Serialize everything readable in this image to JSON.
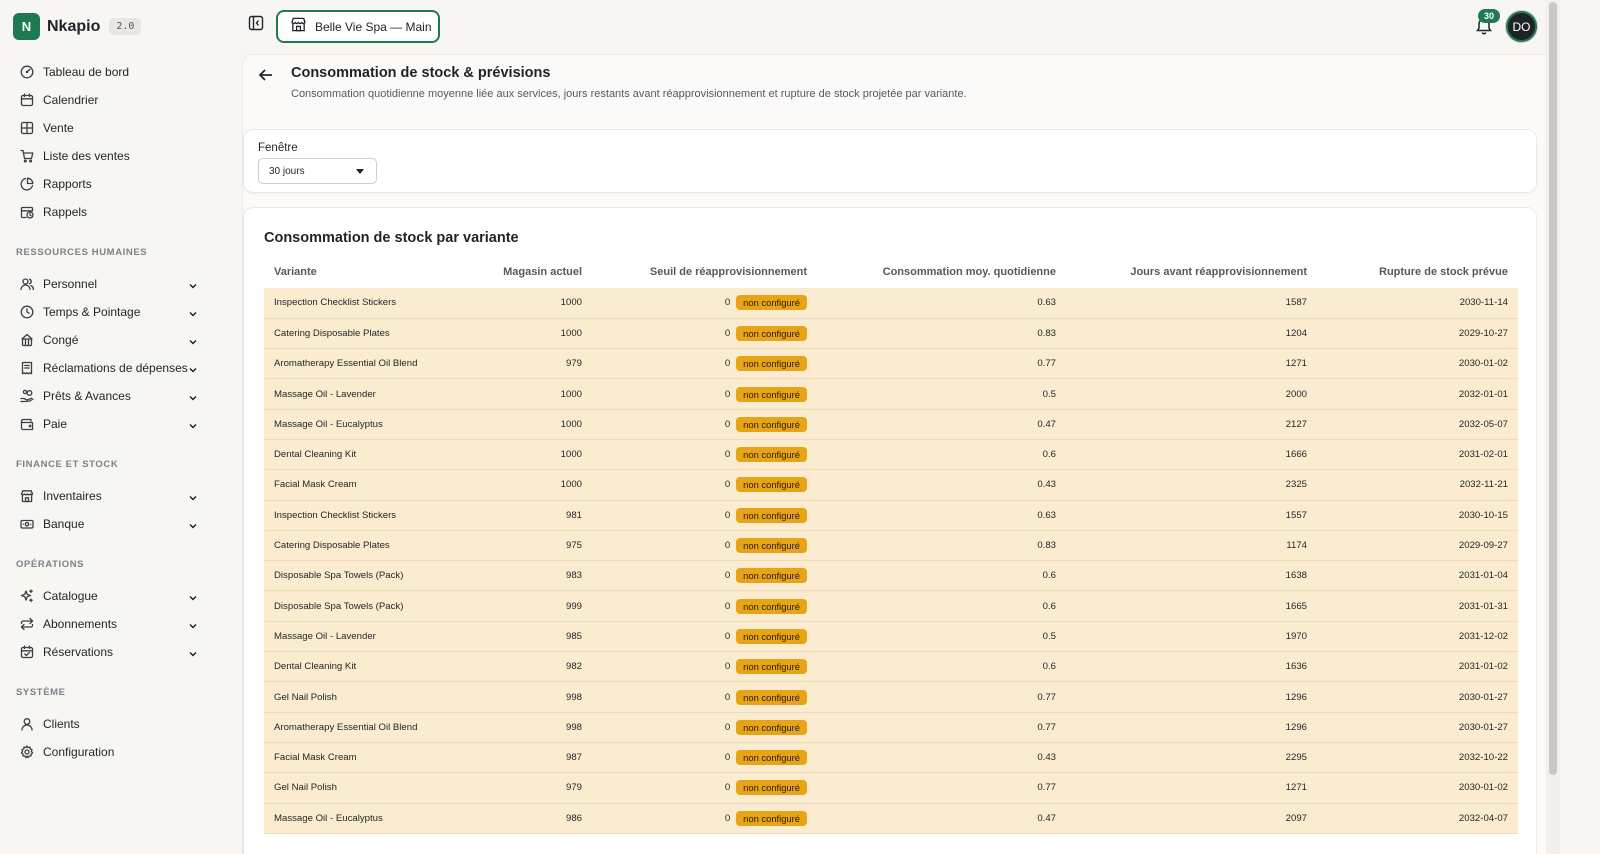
{
  "brand": {
    "logo_letter": "N",
    "name": "Nkapio",
    "version": "2.0"
  },
  "store": {
    "label": "Belle Vie Spa — Main"
  },
  "notifications": {
    "count": "30"
  },
  "user": {
    "initials": "DO"
  },
  "nav": {
    "top": [
      {
        "label": "Tableau de bord",
        "icon": "dashboard-icon"
      },
      {
        "label": "Calendrier",
        "icon": "calendar-icon"
      },
      {
        "label": "Vente",
        "icon": "grid-icon"
      },
      {
        "label": "Liste des ventes",
        "icon": "cart-icon"
      },
      {
        "label": "Rapports",
        "icon": "pie-chart-icon"
      },
      {
        "label": "Rappels",
        "icon": "calendar-clock-icon"
      }
    ],
    "sections": [
      {
        "title": "RESSOURCES HUMAINES",
        "items": [
          {
            "label": "Personnel",
            "icon": "users-icon"
          },
          {
            "label": "Temps & Pointage",
            "icon": "clock-icon"
          },
          {
            "label": "Congé",
            "icon": "plane-icon"
          },
          {
            "label": "Réclamations de dépenses",
            "icon": "receipt-icon"
          },
          {
            "label": "Prêts & Avances",
            "icon": "hand-coins-icon"
          },
          {
            "label": "Paie",
            "icon": "wallet-icon"
          }
        ]
      },
      {
        "title": "FINANCE ET STOCK",
        "items": [
          {
            "label": "Inventaires",
            "icon": "warehouse-icon"
          },
          {
            "label": "Banque",
            "icon": "banknote-icon"
          }
        ]
      },
      {
        "title": "OPÉRATIONS",
        "items": [
          {
            "label": "Catalogue",
            "icon": "sparkles-icon"
          },
          {
            "label": "Abonnements",
            "icon": "repeat-icon"
          },
          {
            "label": "Réservations",
            "icon": "calendar-check-icon"
          }
        ]
      },
      {
        "title": "SYSTÈME",
        "items": [
          {
            "label": "Clients",
            "icon": "user-icon"
          },
          {
            "label": "Configuration",
            "icon": "settings-icon"
          }
        ]
      }
    ]
  },
  "page": {
    "title": "Consommation de stock & prévisions",
    "subtitle": "Consommation quotidienne moyenne liée aux services, jours restants avant réapprovisionnement et rupture de stock projetée par variante."
  },
  "filter": {
    "label": "Fenêtre",
    "value": "30 jours"
  },
  "table": {
    "title": "Consommation de stock par variante",
    "columns": [
      "Variante",
      "Magasin actuel",
      "Seuil de réapprovisionnement",
      "Consommation moy. quotidienne",
      "Jours avant réapprovisionnement",
      "Rupture de stock prévue"
    ],
    "badge_label": "non configuré",
    "rows": [
      [
        "Inspection Checklist Stickers",
        "1000",
        "0",
        "0.63",
        "1587",
        "2030-11-14"
      ],
      [
        "Catering Disposable Plates",
        "1000",
        "0",
        "0.83",
        "1204",
        "2029-10-27"
      ],
      [
        "Aromatherapy Essential Oil Blend",
        "979",
        "0",
        "0.77",
        "1271",
        "2030-01-02"
      ],
      [
        "Massage Oil - Lavender",
        "1000",
        "0",
        "0.5",
        "2000",
        "2032-01-01"
      ],
      [
        "Massage Oil - Eucalyptus",
        "1000",
        "0",
        "0.47",
        "2127",
        "2032-05-07"
      ],
      [
        "Dental Cleaning Kit",
        "1000",
        "0",
        "0.6",
        "1666",
        "2031-02-01"
      ],
      [
        "Facial Mask Cream",
        "1000",
        "0",
        "0.43",
        "2325",
        "2032-11-21"
      ],
      [
        "Inspection Checklist Stickers",
        "981",
        "0",
        "0.63",
        "1557",
        "2030-10-15"
      ],
      [
        "Catering Disposable Plates",
        "975",
        "0",
        "0.83",
        "1174",
        "2029-09-27"
      ],
      [
        "Disposable Spa Towels (Pack)",
        "983",
        "0",
        "0.6",
        "1638",
        "2031-01-04"
      ],
      [
        "Disposable Spa Towels (Pack)",
        "999",
        "0",
        "0.6",
        "1665",
        "2031-01-31"
      ],
      [
        "Massage Oil - Lavender",
        "985",
        "0",
        "0.5",
        "1970",
        "2031-12-02"
      ],
      [
        "Dental Cleaning Kit",
        "982",
        "0",
        "0.6",
        "1636",
        "2031-01-02"
      ],
      [
        "Gel Nail Polish",
        "998",
        "0",
        "0.77",
        "1296",
        "2030-01-27"
      ],
      [
        "Aromatherapy Essential Oil Blend",
        "998",
        "0",
        "0.77",
        "1296",
        "2030-01-27"
      ],
      [
        "Facial Mask Cream",
        "987",
        "0",
        "0.43",
        "2295",
        "2032-10-22"
      ],
      [
        "Gel Nail Polish",
        "979",
        "0",
        "0.77",
        "1271",
        "2030-01-02"
      ],
      [
        "Massage Oil - Eucalyptus",
        "986",
        "0",
        "0.47",
        "2097",
        "2032-04-07"
      ]
    ]
  },
  "colors": {
    "brand": "#1f7a52",
    "row_bg": "#fbecd0",
    "badge": "#e8a417"
  }
}
